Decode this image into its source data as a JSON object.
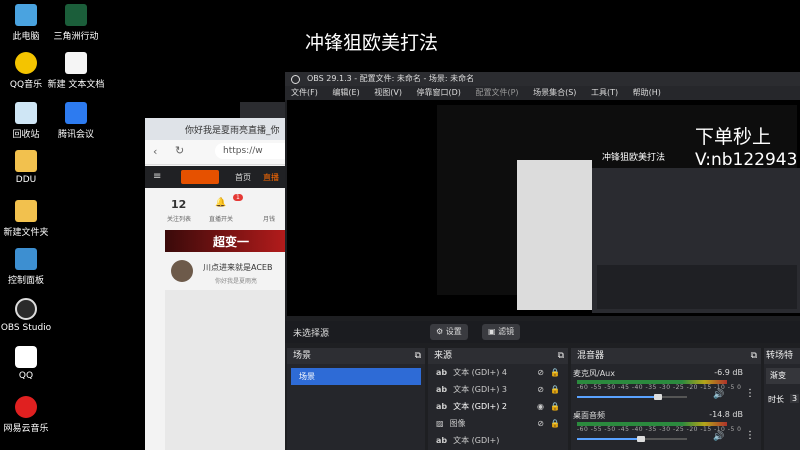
{
  "desktop": {
    "icons": [
      {
        "label": "此电脑",
        "name": "this-pc-icon"
      },
      {
        "label": "三角洲行动",
        "name": "game-delta-icon"
      },
      {
        "label": "QQ音乐",
        "name": "qq-music-icon"
      },
      {
        "label": "新建 文本文档",
        "name": "text-document-icon"
      },
      {
        "label": "回收站",
        "name": "recycle-bin-icon"
      },
      {
        "label": "腾讯会议",
        "name": "tencent-meeting-icon"
      },
      {
        "label": "DDU",
        "name": "folder-icon"
      },
      {
        "label": "新建文件夹",
        "name": "folder-icon"
      },
      {
        "label": "控制面板",
        "name": "control-panel-icon"
      },
      {
        "label": "OBS Studio",
        "name": "obs-studio-icon"
      },
      {
        "label": "QQ",
        "name": "qq-icon"
      },
      {
        "label": "网易云音乐",
        "name": "netease-music-icon"
      }
    ],
    "overlay_title": "冲锋狙欧美打法",
    "overlay_right_1": "下单秒上",
    "overlay_right_2": "V:nb122943"
  },
  "browser": {
    "tab_title": "你好我是夏雨亮直播_你",
    "address": "https://w",
    "site_nav_home": "首页",
    "site_nav_hot": "直播",
    "stats_num": "12",
    "stats_label": "关注列表",
    "stats_label2": "直播开关",
    "stats_label3": "月钱",
    "badge_count": "1",
    "banner_text": "超变一",
    "user_post_title": "川点进来就是ACEB",
    "user_post_meta": "你好我是夏雨亮"
  },
  "obs": {
    "title": "OBS 29.1.3 - 配置文件: 未命名 - 场景: 未命名",
    "menu": [
      "文件(F)",
      "编辑(E)",
      "视图(V)",
      "停靠窗口(D)",
      "配置文件(P)",
      "场景集合(S)",
      "工具(T)",
      "帮助(H)"
    ],
    "no_source": "未选择源",
    "settings_btn": "设置",
    "filters_btn": "滤镜",
    "scenes_header": "场景",
    "scenes": [
      "场景"
    ],
    "sources_header": "来源",
    "sources": [
      "文本 (GDI+) 4",
      "文本 (GDI+) 3",
      "文本 (GDI+) 2",
      "图像",
      "文本 (GDI+)"
    ],
    "mixer_header": "混音器",
    "mixer": [
      {
        "name": "麦克风/Aux",
        "db": "-6.9 dB",
        "level": 0.74
      },
      {
        "name": "桌面音频",
        "db": "-14.8 dB",
        "level": 0.58
      }
    ],
    "ticks": "-60 -55 -50 -45 -40 -35 -30 -25 -20 -15 -10 -5 0",
    "transitions_header": "转场特",
    "transition_value": "渐变",
    "duration_label": "时长",
    "duration_value": "3"
  }
}
